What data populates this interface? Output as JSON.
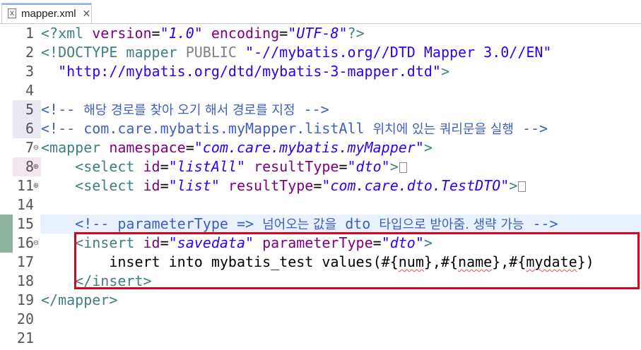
{
  "tab": {
    "title": "mapper.xml",
    "icon": "xml-file-icon",
    "close": "✕"
  },
  "highlight_color": "#e0001a",
  "lines": [
    {
      "num": "1",
      "parts": [
        [
          "t-tag",
          "<?xml "
        ],
        [
          "t-attr",
          "version"
        ],
        [
          "",
          "="
        ],
        [
          "t-val",
          "\"1.0\""
        ],
        [
          "t-attr",
          " encoding"
        ],
        [
          "",
          "="
        ],
        [
          "t-val",
          "\"UTF-8\""
        ],
        [
          "t-tag",
          "?>"
        ]
      ]
    },
    {
      "num": "2",
      "parts": [
        [
          "t-tag",
          "<!DOCTYPE mapper "
        ],
        [
          "t-gray",
          "PUBLIC "
        ],
        [
          "t-str",
          "\"-//mybatis.org//DTD Mapper 3.0//EN\""
        ]
      ]
    },
    {
      "num": "3",
      "parts": [
        [
          "t-str",
          "  \"http://mybatis.org/dtd/mybatis-3-mapper.dtd\""
        ],
        [
          "t-tag",
          ">"
        ]
      ]
    },
    {
      "num": "4",
      "parts": []
    },
    {
      "num": "5",
      "parts": [
        [
          "t-com",
          "<!-- "
        ],
        [
          "t-com t-kor",
          "해당 경로를 찾아 오기 해서 경로를 지정"
        ],
        [
          "t-com",
          " -->"
        ]
      ]
    },
    {
      "num": "6",
      "parts": [
        [
          "t-com",
          "<!-- com.care.mybatis.myMapper.listAll "
        ],
        [
          "t-com t-kor",
          "위치에 있는 쿼리문을 실행"
        ],
        [
          "t-com",
          " -->"
        ]
      ]
    },
    {
      "num": "7",
      "fold": "⊖",
      "parts": [
        [
          "t-tag",
          "<mapper "
        ],
        [
          "t-attr",
          "namespace"
        ],
        [
          "",
          "="
        ],
        [
          "t-val",
          "\"com.care.mybatis.myMapper\""
        ],
        [
          "t-tag",
          ">"
        ]
      ]
    },
    {
      "num": "8",
      "fold": "⊕",
      "parts": [
        [
          "t-tag",
          "    <select "
        ],
        [
          "t-attr",
          "id"
        ],
        [
          "",
          "="
        ],
        [
          "t-val",
          "\"listAll\""
        ],
        [
          "t-attr",
          " resultType"
        ],
        [
          "",
          "="
        ],
        [
          "t-val",
          "\"dto\""
        ],
        [
          "t-tag",
          ">"
        ],
        [
          "fold-box",
          ""
        ]
      ]
    },
    {
      "num": "11",
      "fold": "⊕",
      "parts": [
        [
          "t-tag",
          "    <select "
        ],
        [
          "t-attr",
          "id"
        ],
        [
          "",
          "="
        ],
        [
          "t-val",
          "\"list\""
        ],
        [
          "t-attr",
          " resultType"
        ],
        [
          "",
          "="
        ],
        [
          "t-val",
          "\"com.care.dto.TestDTO\""
        ],
        [
          "t-tag",
          ">"
        ],
        [
          "fold-box",
          ""
        ]
      ]
    },
    {
      "num": "14",
      "parts": []
    },
    {
      "num": "15",
      "current": true,
      "parts": [
        [
          "t-com",
          "    <!-- parameterType => "
        ],
        [
          "t-com t-kor",
          "넘어오는 값을"
        ],
        [
          "t-com",
          " dto "
        ],
        [
          "t-com t-kor",
          "타입으로 받아줌. 생략 가능"
        ],
        [
          "t-com",
          " -->"
        ]
      ]
    },
    {
      "num": "16",
      "fold": "⊖",
      "parts": [
        [
          "t-tag",
          "    <insert "
        ],
        [
          "t-attr",
          "id"
        ],
        [
          "",
          "="
        ],
        [
          "t-val",
          "\"savedata\""
        ],
        [
          "t-attr",
          " parameterType"
        ],
        [
          "",
          "="
        ],
        [
          "t-val",
          "\"dto\""
        ],
        [
          "t-tag",
          ">"
        ]
      ]
    },
    {
      "num": "17",
      "parts": [
        [
          "",
          "        insert into mybatis_test values(#{"
        ],
        [
          "sq",
          "num"
        ],
        [
          "",
          "},#{"
        ],
        [
          "sq",
          "name"
        ],
        [
          "",
          "},#{"
        ],
        [
          "sq",
          "mydate"
        ],
        [
          "",
          "})"
        ]
      ]
    },
    {
      "num": "18",
      "parts": [
        [
          "t-tag",
          "    </insert>"
        ]
      ]
    },
    {
      "num": "19",
      "parts": [
        [
          "t-tag",
          "</mapper>"
        ]
      ]
    },
    {
      "num": "20",
      "parts": []
    },
    {
      "num": "21",
      "parts": []
    }
  ]
}
